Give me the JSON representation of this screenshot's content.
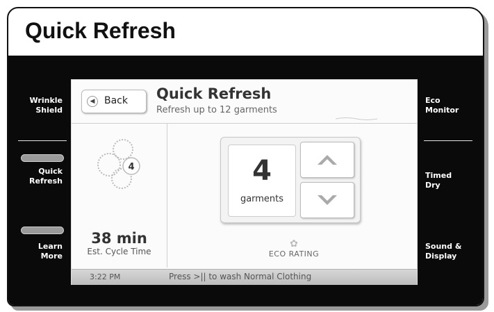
{
  "title": "Quick Refresh",
  "left_menu": {
    "wrinkle_shield": "Wrinkle\nShield",
    "quick_refresh": "Quick\nRefresh",
    "learn_more": "Learn\nMore"
  },
  "right_menu": {
    "eco_monitor": "Eco\nMonitor",
    "timed_dry": "Timed\nDry",
    "sound_display": "Sound &\nDisplay"
  },
  "screen": {
    "back_label": "Back",
    "title": "Quick Refresh",
    "subtitle": "Refresh up to 12 garments",
    "drum_badge": "4",
    "cycle_time": "38 min",
    "cycle_label": "Est. Cycle Time",
    "count_value": "4",
    "count_unit": "garments",
    "eco_label": "ECO RATING",
    "footer_time": "3:22 PM",
    "footer_message": "Press >|| to wash Normal Clothing"
  },
  "colors": {
    "panel": "#0a0a0a",
    "screen": "#fbfbfb",
    "footer": "#c8c8c8"
  }
}
